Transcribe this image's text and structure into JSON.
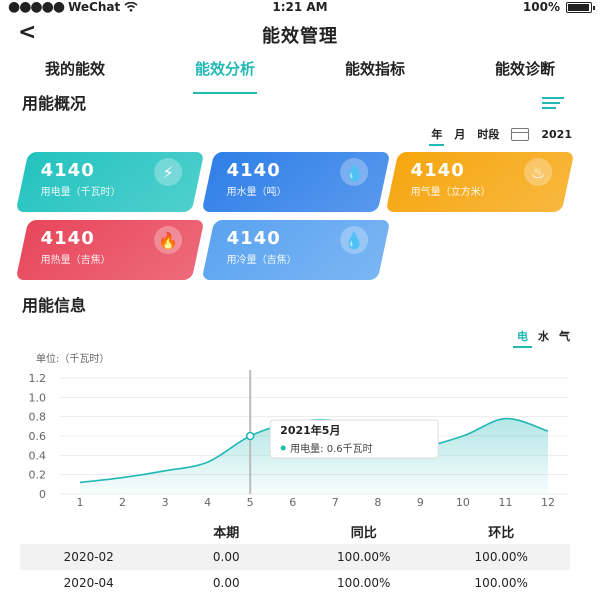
{
  "status": {
    "carrier": "WeChat",
    "time": "1:21 AM",
    "battery": "100%",
    "battery_level": 1.0
  },
  "nav": {
    "back": "<",
    "title": "能效管理"
  },
  "tabs": [
    {
      "label": "我的能效",
      "active": false
    },
    {
      "label": "能效分析",
      "active": true
    },
    {
      "label": "能效指标",
      "active": false
    },
    {
      "label": "能效诊断",
      "active": false
    }
  ],
  "overview": {
    "title": "用能概况"
  },
  "period": {
    "year": "年",
    "month": "月",
    "segment": "时段",
    "year_value": "2021"
  },
  "cards": [
    {
      "value": "4140",
      "label": "用电量（千瓦时）",
      "icon": "lightning-icon",
      "color": "#23c3c0"
    },
    {
      "value": "4140",
      "label": "用水量（吨）",
      "icon": "water-drop-icon",
      "color": "#2f7fe8"
    },
    {
      "value": "4140",
      "label": "用气量（立方米）",
      "icon": "steam-icon",
      "color": "#f6a60f"
    },
    {
      "value": "4140",
      "label": "用热量（吉焦）",
      "icon": "flame-icon",
      "color": "#e8465a"
    },
    {
      "value": "4140",
      "label": "用冷量（吉焦）",
      "icon": "cold-water-icon",
      "color": "#5aa3f0"
    }
  ],
  "info": {
    "title": "用能信息",
    "unit": "单位:（千瓦时）"
  },
  "energy_types": {
    "elec": "电",
    "water": "水",
    "gas": "气"
  },
  "tooltip": {
    "title": "2021年5月",
    "text": "用电量:  0.6千瓦时"
  },
  "chart_data": {
    "type": "area",
    "x": [
      1,
      2,
      3,
      4,
      5,
      6,
      7,
      8,
      9,
      10,
      11,
      12
    ],
    "series": [
      {
        "name": "用电量",
        "values": [
          0.12,
          0.17,
          0.24,
          0.33,
          0.6,
          0.74,
          0.76,
          0.63,
          0.5,
          0.6,
          0.78,
          0.65
        ]
      }
    ],
    "xlim": [
      1,
      12
    ],
    "ylim": [
      0,
      1.2
    ],
    "yticks": [
      0,
      0.2,
      0.4,
      0.6,
      0.8,
      1.0,
      1.2
    ],
    "ytick_labels": [
      "0",
      "0.2",
      "0.4",
      "0.6",
      "0.8",
      "1.0",
      "1.2"
    ],
    "highlight_x": 5,
    "color": "#21b8b5",
    "grid": true
  },
  "table": {
    "headers": [
      "",
      "本期",
      "同比",
      "环比"
    ],
    "rows": [
      [
        "2020-02",
        "0.00",
        "100.00%",
        "100.00%"
      ],
      [
        "2020-04",
        "0.00",
        "100.00%",
        "100.00%"
      ]
    ]
  }
}
